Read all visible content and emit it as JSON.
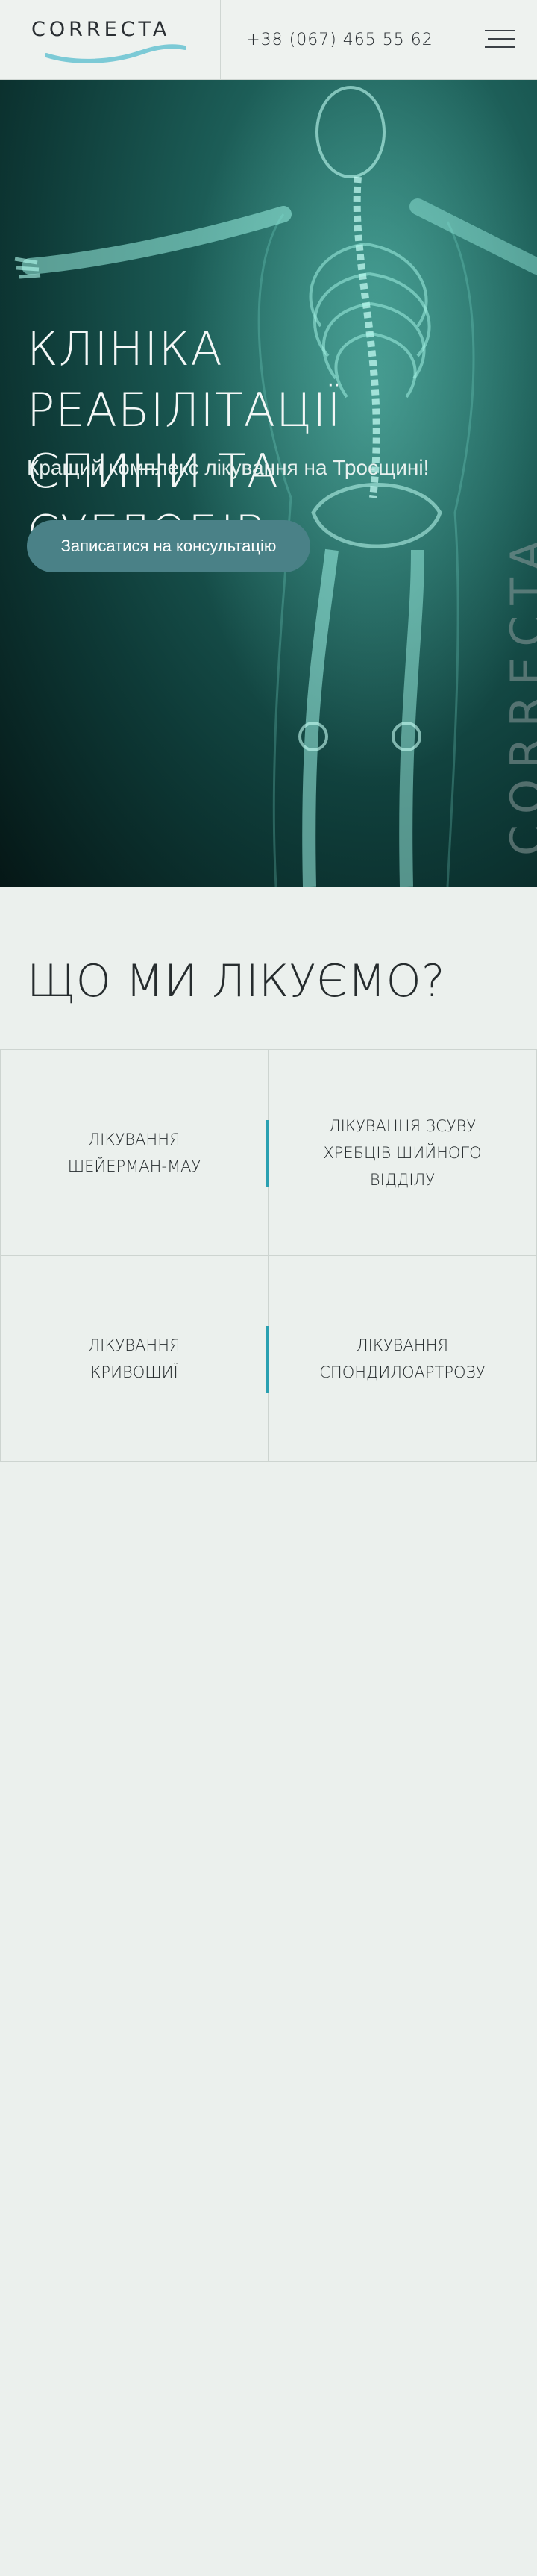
{
  "header": {
    "logo": "CORRECTA",
    "phone": "+38 (067) 465 55 62",
    "menu_icon": "hamburger-icon"
  },
  "hero": {
    "title_line1": "КЛІНІКА РЕАБІЛІТАЦІЇ",
    "title_line2": "СПИНИ ТА СУГЛОБІВ",
    "subtitle": "Кращий комплекс лікування на Троєщині!",
    "cta": "Записатися на консультацію",
    "vertical_brand": "CORRECTA"
  },
  "treatments": {
    "title": "ЩО МИ ЛІКУЄМО?",
    "items": [
      {
        "label": "ЛІКУВАННЯ\nШЕЙЕРМАН-МАУ"
      },
      {
        "label": "ЛІКУВАННЯ ЗСУВУ\nХРЕБЦІВ ШИЙНОГО\nВІДДІЛУ"
      },
      {
        "label": "ЛІКУВАННЯ\nКРИВОШИЇ"
      },
      {
        "label": "ЛІКУВАННЯ\nСПОНДИЛОАРТРОЗУ"
      }
    ]
  },
  "colors": {
    "accent": "#2aa0b1",
    "button": "#4a8187",
    "background": "#ebf0ed",
    "hero_dark": "#0e3a37"
  }
}
